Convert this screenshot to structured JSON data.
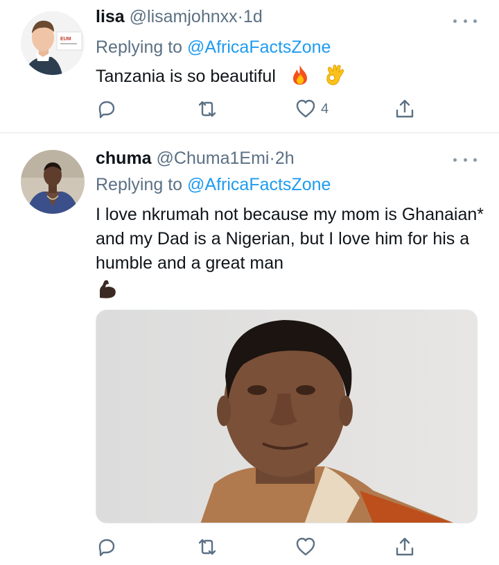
{
  "tweets": [
    {
      "name": "lisa",
      "handle": "@lisamjohnxx",
      "dot": "·",
      "time": "1d",
      "replying_prefix": "Replying to",
      "replying_to": "@AfricaFactsZone",
      "text": "Tanzania is so beautiful",
      "emojis": [
        "fire",
        "ok-hand"
      ],
      "reply_count": "",
      "retweet_count": "",
      "like_count": "4",
      "avatar_lettering": "EUM"
    },
    {
      "name": "chuma",
      "handle": "@Chuma1Emi",
      "dot": "·",
      "time": "2h",
      "replying_prefix": "Replying to",
      "replying_to": "@AfricaFactsZone",
      "text": "I love nkrumah not because my mom is Ghanaian* and my Dad is a Nigerian, but I love him for his a humble and a great man",
      "emojis": [
        "flexed-biceps"
      ],
      "reply_count": "",
      "retweet_count": "",
      "like_count": "",
      "media": "portrait photo of a man"
    }
  ],
  "colors": {
    "text": "#0f1419",
    "secondary": "#5b7083",
    "link": "#1d9bf0",
    "divider": "#e1e6ea"
  }
}
